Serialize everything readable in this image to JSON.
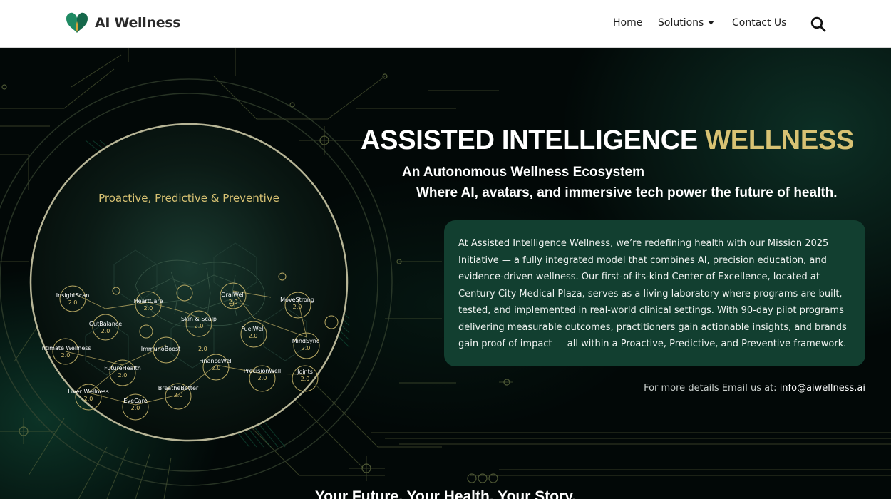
{
  "header": {
    "brand": "AI Wellness",
    "logo_icon": "twin-leaf-heart-logo",
    "nav": {
      "home": "Home",
      "solutions": "Solutions",
      "contact": "Contact Us"
    },
    "search_icon": "search-icon"
  },
  "hero": {
    "title_main": "ASSISTED INTELLIGENCE",
    "title_accent": "WELLNESS",
    "subtitle_1": "An Autonomous Wellness Ecosystem",
    "subtitle_2": "Where AI, avatars, and immersive tech power the future of health.",
    "description": "At Assisted Intelligence Wellness, we’re redefining health with our Mission 2025 Initiative — a fully integrated model that combines AI, precision education, and evidence-driven wellness. Our first-of-its-kind Center of Excellence, located at Century City Medical Plaza, serves as a living laboratory where programs are built, tested, and implemented in real-world clinical settings. With 90-day pilot programs delivering measurable outcomes, practitioners gain actionable insights, and brands gain proof of impact — all within a Proactive, Predictive, and Preventive framework.",
    "email_prompt": "For more details Email us at:",
    "email": "info@aiwellness.ai"
  },
  "diagram": {
    "title": "Proactive, Predictive & Preventive",
    "version": "2.0",
    "nodes": [
      {
        "name": "InsightScan"
      },
      {
        "name": "HeartCare"
      },
      {
        "name": "OralWell"
      },
      {
        "name": "MoveStrong"
      },
      {
        "name": "GutBalance"
      },
      {
        "name": "Skin & Scalp"
      },
      {
        "name": "FuelWell"
      },
      {
        "name": "Intimate Wellness"
      },
      {
        "name": "ImmunoBoost"
      },
      {
        "name": "MindSync"
      },
      {
        "name": "FinanceWell"
      },
      {
        "name": "FutureHealth"
      },
      {
        "name": "PrecisionWell"
      },
      {
        "name": "Joints"
      },
      {
        "name": "BreatheBetter"
      },
      {
        "name": "Liver Wellness"
      },
      {
        "name": "EyeCare"
      }
    ]
  },
  "section": {
    "heading": "Your Future. Your Health. Your Story."
  },
  "colors": {
    "accent_gold": "#d8c273",
    "card_green": "#123f30",
    "hero_background": "#020807",
    "header_background": "#ffffff",
    "logo_green": "#1f8a63"
  }
}
